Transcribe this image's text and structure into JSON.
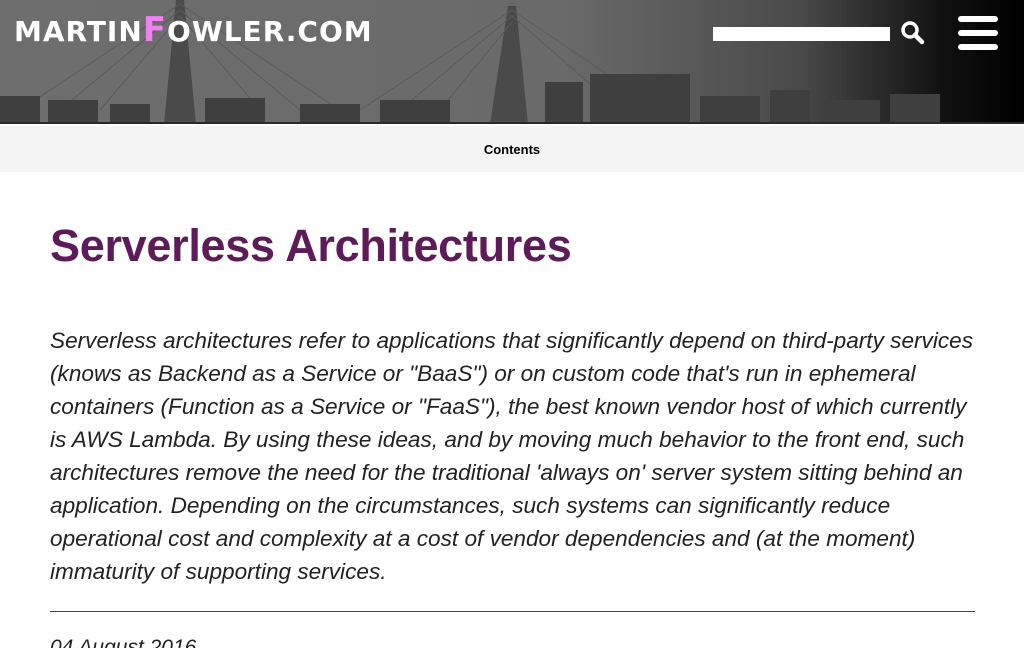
{
  "header": {
    "logo": {
      "part1": "Martin",
      "f": "F",
      "part2": "owler",
      "part3": ".com"
    },
    "search": {
      "value": "",
      "placeholder": ""
    },
    "icons": {
      "search": "search-icon",
      "menu": "hamburger-menu-icon"
    }
  },
  "nav": {
    "contents_label": "Contents"
  },
  "article": {
    "title": "Serverless Architectures",
    "abstract": "Serverless architectures refer to applications that significantly depend on third-party services (knows as Backend as a Service or \"BaaS\") or on custom code that's run in ephemeral containers (Function as a Service or \"FaaS\"), the best known vendor host of which currently is AWS Lambda. By using these ideas, and by moving much behavior to the front end, such architectures remove the need for the traditional 'always on' server system sitting behind an application. Depending on the circumstances, such systems can significantly reduce operational cost and complexity at a cost of vendor dependencies and (at the moment) immaturity of supporting services.",
    "date": "04 August 2016"
  },
  "colors": {
    "title": "#5e1b59",
    "logo_accent": "#ee82ee",
    "rule": "#6a2a64"
  }
}
